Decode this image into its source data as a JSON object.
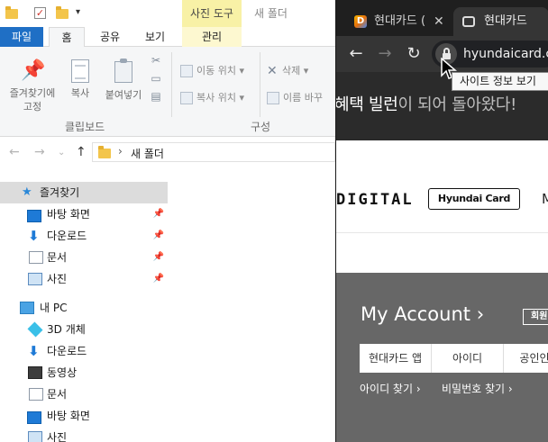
{
  "explorer": {
    "title_context": "사진 도구",
    "window_title": "새 폴더",
    "tabs": {
      "file": "파일",
      "home": "홈",
      "share": "공유",
      "view": "보기",
      "manage": "관리"
    },
    "ribbon": {
      "pin_quick_access": "즐겨찾기에\n고정",
      "copy": "복사",
      "paste": "붙여넣기",
      "move_to": "이동 위치",
      "copy_to": "복사 위치",
      "delete": "삭제",
      "rename": "이름 바꾸",
      "group_clipboard": "클립보드",
      "group_organize": "구성"
    },
    "address": {
      "path": "새 폴더",
      "separator": "›"
    },
    "nav": {
      "quick_access": "즐겨찾기",
      "qa_items": [
        "바탕 화면",
        "다운로드",
        "문서",
        "사진"
      ],
      "this_pc": "내 PC",
      "pc_items": [
        "3D 개체",
        "다운로드",
        "동영상",
        "문서",
        "바탕 화면",
        "사진"
      ]
    }
  },
  "chrome": {
    "tabs": [
      {
        "label": "현대카드 (",
        "favicon": "D"
      },
      {
        "label": "현대카드"
      }
    ],
    "url": "hyundaicard.com",
    "tooltip": "사이트 정보 보기"
  },
  "webpage": {
    "banner_bright": "혜택 빌런",
    "banner_dim": "이 되어 돌아왔다!",
    "brand_text": "DIGITAL",
    "logo_text": "Hyundai Card",
    "cut_menu": "M",
    "account_title": "My Account",
    "account_title_chevron": "›",
    "account_badge": "회원",
    "login_tabs": [
      "현대카드 앱",
      "아이디",
      "공인인증"
    ],
    "links": [
      "아이디 찾기 ›",
      "비밀번호 찾기 ›"
    ]
  }
}
